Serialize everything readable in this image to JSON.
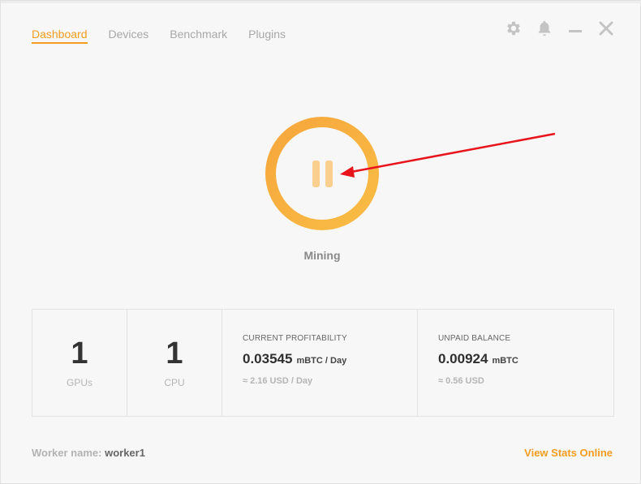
{
  "nav": {
    "tabs": [
      {
        "label": "Dashboard",
        "active": true
      },
      {
        "label": "Devices",
        "active": false
      },
      {
        "label": "Benchmark",
        "active": false
      },
      {
        "label": "Plugins",
        "active": false
      }
    ]
  },
  "window_controls": [
    "gear-icon",
    "bell-icon",
    "minimize-icon",
    "close-icon"
  ],
  "mining": {
    "status": "Mining",
    "button_icon": "pause-icon",
    "ring_colors": [
      "#f6a53c",
      "#f9be45"
    ]
  },
  "stats": {
    "gpus": {
      "value": "1",
      "label": "GPUs"
    },
    "cpu": {
      "value": "1",
      "label": "CPU"
    },
    "profitability": {
      "title": "CURRENT PROFITABILITY",
      "value": "0.03545",
      "unit": "mBTC / Day",
      "fiat": "≈ 2.16 USD / Day"
    },
    "balance": {
      "title": "UNPAID BALANCE",
      "value": "0.00924",
      "unit": "mBTC",
      "fiat": "≈ 0.56 USD"
    }
  },
  "footer": {
    "worker_label": "Worker name:",
    "worker_value": "worker1",
    "view_stats": "View Stats Online"
  },
  "colors": {
    "accent": "#f39c1f",
    "annotation": "#e8141c"
  }
}
